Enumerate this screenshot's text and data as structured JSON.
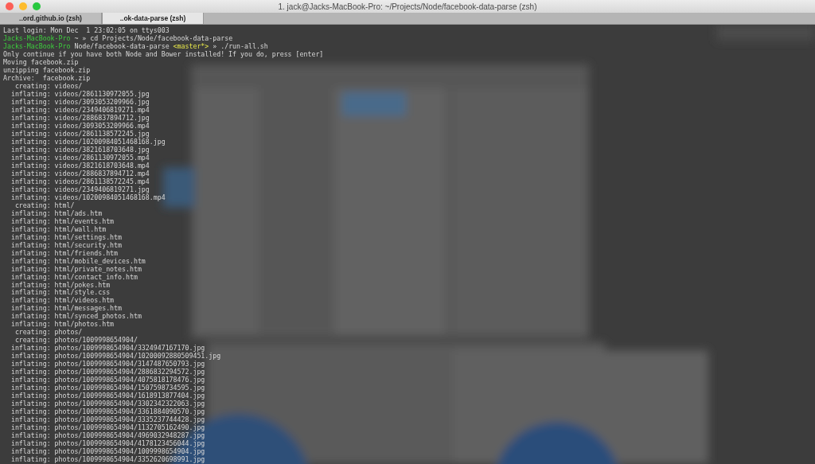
{
  "window": {
    "title": "1. jack@Jacks-MacBook-Pro: ~/Projects/Node/facebook-data-parse (zsh)"
  },
  "tabs": [
    {
      "label": "..ord.github.io (zsh)",
      "selected": false
    },
    {
      "label": "..ok-data-parse (zsh)",
      "selected": true
    }
  ],
  "background": {
    "kind": "picture"
  },
  "lines": [
    [
      {
        "text": "Last login: Mon Dec  1 23:02:05 on ttys003",
        "kind": "plain"
      }
    ],
    [
      {
        "text": "Jacks-MacBook-Pro",
        "kind": "host"
      },
      {
        "text": " ~ » cd Projects/Node/facebook-data-parse",
        "kind": "plain"
      }
    ],
    [
      {
        "text": "Jacks-MacBook-Pro",
        "kind": "host"
      },
      {
        "text": " Node/facebook-data-parse ",
        "kind": "plain"
      },
      {
        "text": "<master*>",
        "kind": "branch"
      },
      {
        "text": " » ./run-all.sh",
        "kind": "plain"
      }
    ],
    [
      {
        "text": "Only continue if you have both Node and Bower installed! If you do, press [enter]",
        "kind": "plain"
      }
    ],
    [
      {
        "text": "Moving facebook.zip",
        "kind": "plain"
      }
    ],
    [
      {
        "text": "unzipping facebook.zip",
        "kind": "plain"
      }
    ],
    [
      {
        "text": "Archive:  facebook.zip",
        "kind": "plain"
      }
    ],
    [
      {
        "text": "   creating: videos/",
        "kind": "plain"
      }
    ],
    [
      {
        "text": "  inflating: videos/2861130972055.jpg",
        "kind": "plain"
      }
    ],
    [
      {
        "text": "  inflating: videos/3093053209966.jpg",
        "kind": "plain"
      }
    ],
    [
      {
        "text": "  inflating: videos/2349406819271.mp4",
        "kind": "plain"
      }
    ],
    [
      {
        "text": "  inflating: videos/2886837894712.jpg",
        "kind": "plain"
      }
    ],
    [
      {
        "text": "  inflating: videos/3093053209966.mp4",
        "kind": "plain"
      }
    ],
    [
      {
        "text": "  inflating: videos/2861138572245.jpg",
        "kind": "plain"
      }
    ],
    [
      {
        "text": "  inflating: videos/10200984051468168.jpg",
        "kind": "plain"
      }
    ],
    [
      {
        "text": "  inflating: videos/3821618703648.jpg",
        "kind": "plain"
      }
    ],
    [
      {
        "text": "  inflating: videos/2861130972055.mp4",
        "kind": "plain"
      }
    ],
    [
      {
        "text": "  inflating: videos/3821618703648.mp4",
        "kind": "plain"
      }
    ],
    [
      {
        "text": "  inflating: videos/2886837894712.mp4",
        "kind": "plain"
      }
    ],
    [
      {
        "text": "  inflating: videos/2861138572245.mp4",
        "kind": "plain"
      }
    ],
    [
      {
        "text": "  inflating: videos/2349406819271.jpg",
        "kind": "plain"
      }
    ],
    [
      {
        "text": "  inflating: videos/10200984051468168.mp4",
        "kind": "plain"
      }
    ],
    [
      {
        "text": "   creating: html/",
        "kind": "plain"
      }
    ],
    [
      {
        "text": "  inflating: html/ads.htm",
        "kind": "plain"
      }
    ],
    [
      {
        "text": "  inflating: html/events.htm",
        "kind": "plain"
      }
    ],
    [
      {
        "text": "  inflating: html/wall.htm",
        "kind": "plain"
      }
    ],
    [
      {
        "text": "  inflating: html/settings.htm",
        "kind": "plain"
      }
    ],
    [
      {
        "text": "  inflating: html/security.htm",
        "kind": "plain"
      }
    ],
    [
      {
        "text": "  inflating: html/friends.htm",
        "kind": "plain"
      }
    ],
    [
      {
        "text": "  inflating: html/mobile_devices.htm",
        "kind": "plain"
      }
    ],
    [
      {
        "text": "  inflating: html/private_notes.htm",
        "kind": "plain"
      }
    ],
    [
      {
        "text": "  inflating: html/contact_info.htm",
        "kind": "plain"
      }
    ],
    [
      {
        "text": "  inflating: html/pokes.htm",
        "kind": "plain"
      }
    ],
    [
      {
        "text": "  inflating: html/style.css",
        "kind": "plain"
      }
    ],
    [
      {
        "text": "  inflating: html/videos.htm",
        "kind": "plain"
      }
    ],
    [
      {
        "text": "  inflating: html/messages.htm",
        "kind": "plain"
      }
    ],
    [
      {
        "text": "  inflating: html/synced_photos.htm",
        "kind": "plain"
      }
    ],
    [
      {
        "text": "  inflating: html/photos.htm",
        "kind": "plain"
      }
    ],
    [
      {
        "text": "   creating: photos/",
        "kind": "plain"
      }
    ],
    [
      {
        "text": "   creating: photos/1009998654904/",
        "kind": "plain"
      }
    ],
    [
      {
        "text": "  inflating: photos/1009998654904/3324947167170.jpg",
        "kind": "plain"
      }
    ],
    [
      {
        "text": "  inflating: photos/1009998654904/10200092880509451.jpg",
        "kind": "plain"
      }
    ],
    [
      {
        "text": "  inflating: photos/1009998654904/3147487650793.jpg",
        "kind": "plain"
      }
    ],
    [
      {
        "text": "  inflating: photos/1009998654904/2886832294572.jpg",
        "kind": "plain"
      }
    ],
    [
      {
        "text": "  inflating: photos/1009998654904/4075818178476.jpg",
        "kind": "plain"
      }
    ],
    [
      {
        "text": "  inflating: photos/1009998654904/1507598734595.jpg",
        "kind": "plain"
      }
    ],
    [
      {
        "text": "  inflating: photos/1009998654904/1618913877404.jpg",
        "kind": "plain"
      }
    ],
    [
      {
        "text": "  inflating: photos/1009998654904/3302342322063.jpg",
        "kind": "plain"
      }
    ],
    [
      {
        "text": "  inflating: photos/1009998654904/3361884090570.jpg",
        "kind": "plain"
      }
    ],
    [
      {
        "text": "  inflating: photos/1009998654904/3335237744428.jpg",
        "kind": "plain"
      }
    ],
    [
      {
        "text": "  inflating: photos/1009998654904/1132705162490.jpg",
        "kind": "plain"
      }
    ],
    [
      {
        "text": "  inflating: photos/1009998654904/4969032948287.jpg",
        "kind": "plain"
      }
    ],
    [
      {
        "text": "  inflating: photos/1009998654904/4178123456044.jpg",
        "kind": "plain"
      }
    ],
    [
      {
        "text": "  inflating: photos/1009998654904/1009998654904.jpg",
        "kind": "plain"
      }
    ],
    [
      {
        "text": "  inflating: photos/1009998654904/3352620698991.jpg",
        "kind": "plain"
      }
    ]
  ]
}
